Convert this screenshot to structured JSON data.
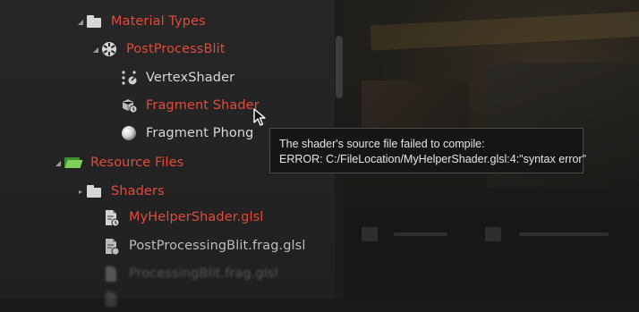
{
  "tree": {
    "material_types": {
      "label": "Material Types",
      "icon": "folder-icon"
    },
    "postprocess_blit": {
      "label": "PostProcessBlit",
      "icon": "shader-group-icon"
    },
    "vertex_shader": {
      "label": "VertexShader",
      "icon": "vertex-shader-icon"
    },
    "fragment_shader": {
      "label": "Fragment Shader",
      "icon": "fragment-shader-icon"
    },
    "fragment_phong": {
      "label": "Fragment Phong",
      "icon": "sphere-icon"
    },
    "resource_files": {
      "label": "Resource Files",
      "icon": "open-folder-icon"
    },
    "shaders": {
      "label": "Shaders",
      "icon": "folder-icon"
    },
    "files": [
      {
        "label": "MyHelperShader.glsl",
        "state": "error"
      },
      {
        "label": "PostProcessingBlit.frag.glsl",
        "state": "normal"
      },
      {
        "label": "ProcessingBlit.frag.glsl",
        "state": "faded"
      },
      {
        "label": "",
        "state": "faded"
      }
    ]
  },
  "tooltip": {
    "line1": "The shader's source file failed to compile:",
    "line2": "ERROR: C:/FileLocation/MyHelperShader.glsl:4:\"syntax error\""
  },
  "colors": {
    "error": "#e24b3c",
    "text": "#d8d8d8",
    "folder_open": "#7fd05a",
    "background": "#1a1a1a"
  }
}
